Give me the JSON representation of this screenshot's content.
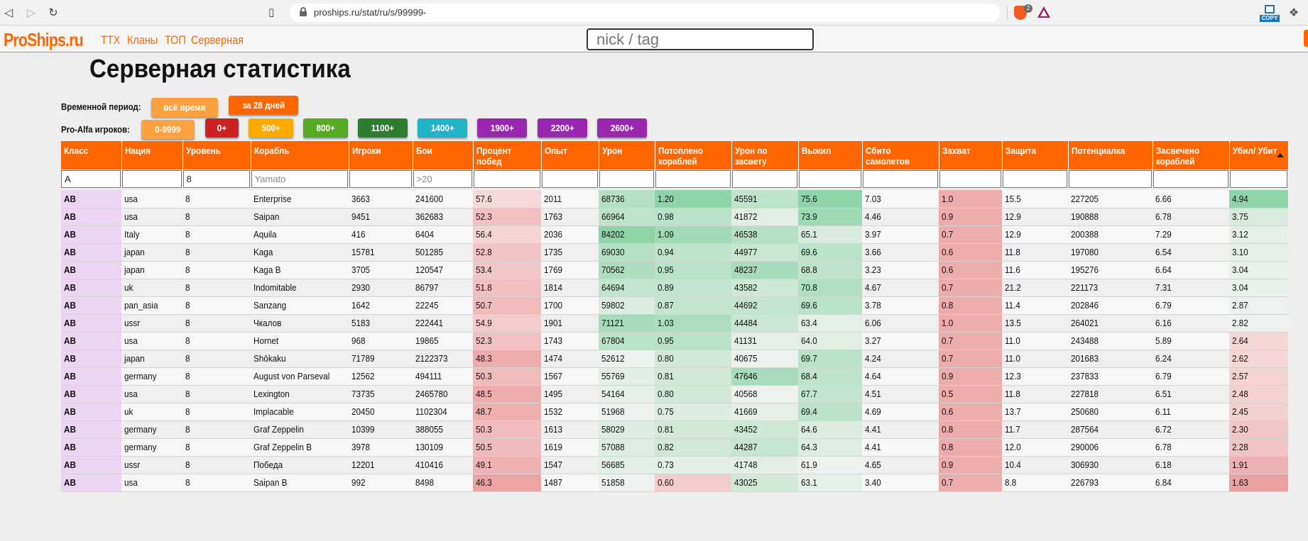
{
  "browser": {
    "url": "proships.ru/stat/ru/s/99999-",
    "extension_badge": "2",
    "copy_extension_label": "COPY"
  },
  "site": {
    "logo": "ProShips.ru",
    "nav": [
      "ТТХ",
      "Кланы",
      "ТОП",
      "Серверная"
    ],
    "search_placeholder": "nick / tag"
  },
  "page_title": "Серверная статистика",
  "period": {
    "label": "Временной период:",
    "options": [
      {
        "label": "всё время",
        "color": "#ffa040",
        "selected": false
      },
      {
        "label": "за 28 дней",
        "color": "#ff6600",
        "selected": true
      }
    ]
  },
  "pro_alfa": {
    "label": "Pro-Alfa игроков:",
    "options": [
      {
        "label": "0-9999",
        "color": "#ffa040"
      },
      {
        "label": "0+",
        "color": "#cc2222"
      },
      {
        "label": "500+",
        "color": "#ffaa00"
      },
      {
        "label": "800+",
        "color": "#55aa22"
      },
      {
        "label": "1100+",
        "color": "#2e7d32"
      },
      {
        "label": "1400+",
        "color": "#22b3c9"
      },
      {
        "label": "1900+",
        "color": "#9b27b0"
      },
      {
        "label": "2200+",
        "color": "#9b27b0"
      },
      {
        "label": "2600+",
        "color": "#9b27b0"
      }
    ]
  },
  "table": {
    "columns": [
      "Класс",
      "Нация",
      "Уровень",
      "Корабль",
      "Игроки",
      "Бои",
      "Процент побед",
      "Опыт",
      "Урон",
      "Потоплено кораблей",
      "Урон по засвету",
      "Выжил",
      "Сбито самолетов",
      "Захват",
      "Защита",
      "Потенциалка",
      "Засвечено кораблей",
      "Убил/ Убит"
    ],
    "sorted_column": "Убил/ Убит",
    "filters": [
      {
        "value": "A",
        "placeholder": ""
      },
      {
        "value": "",
        "placeholder": ""
      },
      {
        "value": "8",
        "placeholder": ""
      },
      {
        "value": "",
        "placeholder": "Yamato"
      },
      {
        "value": "",
        "placeholder": ""
      },
      {
        "value": "",
        "placeholder": ">20"
      },
      {
        "value": "",
        "placeholder": ""
      },
      {
        "value": "",
        "placeholder": ""
      },
      {
        "value": "",
        "placeholder": ""
      },
      {
        "value": "",
        "placeholder": ""
      },
      {
        "value": "",
        "placeholder": ""
      },
      {
        "value": "",
        "placeholder": ""
      },
      {
        "value": "",
        "placeholder": ""
      },
      {
        "value": "",
        "placeholder": ""
      },
      {
        "value": "",
        "placeholder": ""
      },
      {
        "value": "",
        "placeholder": ""
      },
      {
        "value": "",
        "placeholder": ""
      },
      {
        "value": "",
        "placeholder": ""
      }
    ],
    "rows": [
      [
        "AB",
        "usa",
        "8",
        "Enterprise",
        "3663",
        "241600",
        "57.6",
        "2011",
        "68736",
        "1.20",
        "45591",
        "75.6",
        "7.03",
        "1.0",
        "15.5",
        "227205",
        "6.66",
        "4.94"
      ],
      [
        "AB",
        "usa",
        "8",
        "Saipan",
        "9451",
        "362683",
        "52.3",
        "1763",
        "66964",
        "0.98",
        "41872",
        "73.9",
        "4.46",
        "0.9",
        "12.9",
        "190888",
        "6.78",
        "3.75"
      ],
      [
        "AB",
        "Italy",
        "8",
        "Aquila",
        "416",
        "6404",
        "56.4",
        "2036",
        "84202",
        "1.09",
        "46538",
        "65.1",
        "3.97",
        "0.7",
        "12.9",
        "200388",
        "7.29",
        "3.12"
      ],
      [
        "AB",
        "japan",
        "8",
        "Kaga",
        "15781",
        "501285",
        "52.8",
        "1735",
        "69030",
        "0.94",
        "44977",
        "69.6",
        "3.66",
        "0.6",
        "11.8",
        "197080",
        "6.54",
        "3.10"
      ],
      [
        "AB",
        "japan",
        "8",
        "Kaga B",
        "3705",
        "120547",
        "53.4",
        "1769",
        "70562",
        "0.95",
        "48237",
        "68.8",
        "3.23",
        "0.6",
        "11.6",
        "195276",
        "6.64",
        "3.04"
      ],
      [
        "AB",
        "uk",
        "8",
        "Indomitable",
        "2930",
        "86797",
        "51.8",
        "1814",
        "64694",
        "0.89",
        "43582",
        "70.8",
        "4.67",
        "0.7",
        "21.2",
        "221173",
        "7.31",
        "3.04"
      ],
      [
        "AB",
        "pan_asia",
        "8",
        "Sanzang",
        "1642",
        "22245",
        "50.7",
        "1700",
        "59802",
        "0.87",
        "44692",
        "69.6",
        "3.78",
        "0.8",
        "11.4",
        "202846",
        "6.79",
        "2.87"
      ],
      [
        "AB",
        "ussr",
        "8",
        "Чкалов",
        "5183",
        "222441",
        "54.9",
        "1901",
        "71121",
        "1.03",
        "44484",
        "63.4",
        "6.06",
        "1.0",
        "13.5",
        "264021",
        "6.16",
        "2.82"
      ],
      [
        "AB",
        "usa",
        "8",
        "Hornet",
        "968",
        "19865",
        "52.3",
        "1743",
        "67804",
        "0.95",
        "41131",
        "64.0",
        "3.27",
        "0.7",
        "11.0",
        "243488",
        "5.89",
        "2.64"
      ],
      [
        "AB",
        "japan",
        "8",
        "Shōkaku",
        "71789",
        "2122373",
        "48.3",
        "1474",
        "52612",
        "0.80",
        "40675",
        "69.7",
        "4.24",
        "0.7",
        "11.0",
        "201683",
        "6.24",
        "2.62"
      ],
      [
        "AB",
        "germany",
        "8",
        "August von Parseval",
        "12562",
        "494111",
        "50.3",
        "1567",
        "55769",
        "0.81",
        "47646",
        "68.4",
        "4.64",
        "0.9",
        "12.3",
        "237833",
        "6.79",
        "2.57"
      ],
      [
        "AB",
        "usa",
        "8",
        "Lexington",
        "73735",
        "2465780",
        "48.5",
        "1495",
        "54164",
        "0.80",
        "40568",
        "67.7",
        "4.51",
        "0.5",
        "11.8",
        "227818",
        "6.51",
        "2.48"
      ],
      [
        "AB",
        "uk",
        "8",
        "Implacable",
        "20450",
        "1102304",
        "48.7",
        "1532",
        "51968",
        "0.75",
        "41669",
        "69.4",
        "4.69",
        "0.6",
        "13.7",
        "250680",
        "6.11",
        "2.45"
      ],
      [
        "AB",
        "germany",
        "8",
        "Graf Zeppelin",
        "10399",
        "388055",
        "50.3",
        "1613",
        "58029",
        "0.81",
        "43452",
        "64.6",
        "4.41",
        "0.8",
        "11.7",
        "287564",
        "6.72",
        "2.30"
      ],
      [
        "AB",
        "germany",
        "8",
        "Graf Zeppelin B",
        "3978",
        "130109",
        "50.5",
        "1619",
        "57088",
        "0.82",
        "44287",
        "64.3",
        "4.41",
        "0.8",
        "12.0",
        "290006",
        "6.78",
        "2.28"
      ],
      [
        "AB",
        "ussr",
        "8",
        "Победа",
        "12201",
        "410416",
        "49.1",
        "1547",
        "56685",
        "0.73",
        "41748",
        "61.9",
        "4.65",
        "0.9",
        "10.4",
        "306930",
        "6.18",
        "1.91"
      ],
      [
        "AB",
        "usa",
        "8",
        "Saipan B",
        "992",
        "8498",
        "46.3",
        "1487",
        "51858",
        "0.60",
        "43025",
        "63.1",
        "3.40",
        "0.7",
        "8.8",
        "226793",
        "6.84",
        "1.63"
      ]
    ],
    "shading": {
      "class_color": "#ecd5f2",
      "win_rate_heat": [
        0.95,
        0.55,
        0.85,
        0.6,
        0.65,
        0.52,
        0.45,
        0.72,
        0.55,
        0.2,
        0.45,
        0.2,
        0.25,
        0.45,
        0.45,
        0.3,
        0.05
      ],
      "damage_heat": [
        0.6,
        0.5,
        1.0,
        0.6,
        0.7,
        0.45,
        0.2,
        0.75,
        0.55,
        0.02,
        0.12,
        0.08,
        0.0,
        0.2,
        0.17,
        0.15,
        0.0
      ],
      "frags_heat": [
        1.0,
        0.55,
        0.8,
        0.5,
        0.55,
        0.45,
        0.45,
        0.7,
        0.55,
        0.3,
        0.3,
        0.3,
        0.2,
        0.3,
        0.32,
        0.12,
        0.0
      ],
      "spot_damage_heat": [
        0.5,
        0.15,
        0.6,
        0.4,
        0.75,
        0.35,
        0.45,
        0.4,
        0.1,
        0.0,
        0.75,
        0.0,
        0.1,
        0.35,
        0.42,
        0.12,
        0.3
      ],
      "survived_heat": [
        1.0,
        0.85,
        0.25,
        0.55,
        0.5,
        0.65,
        0.55,
        0.1,
        0.15,
        0.55,
        0.5,
        0.45,
        0.55,
        0.2,
        0.18,
        0.0,
        0.08
      ],
      "capture_heat": [
        0.8,
        0.8,
        0.8,
        0.8,
        0.8,
        0.8,
        0.8,
        0.8,
        0.8,
        0.8,
        0.8,
        0.8,
        0.8,
        0.8,
        0.8,
        0.8,
        0.8
      ],
      "kd_heat": [
        1.0,
        0.25,
        0.1,
        0.08,
        0.05,
        0.05,
        0.02,
        0.0,
        -0.05,
        -0.05,
        -0.08,
        -0.1,
        -0.12,
        -0.2,
        -0.22,
        -0.4,
        -0.55
      ]
    }
  }
}
